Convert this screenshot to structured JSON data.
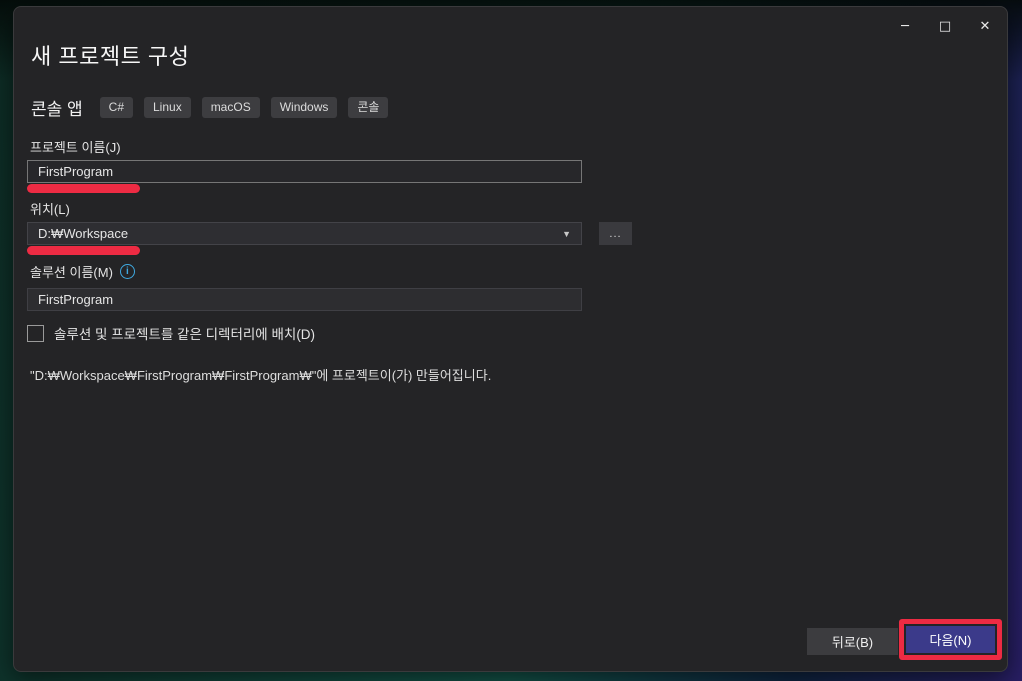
{
  "window": {
    "title": "새 프로젝트 구성",
    "controls": {
      "minimize": "─",
      "maximize": "□",
      "close": "✕"
    }
  },
  "template": {
    "name": "콘솔 앱",
    "tags": [
      "C#",
      "Linux",
      "macOS",
      "Windows",
      "콘솔"
    ]
  },
  "form": {
    "project_name": {
      "label": "프로젝트 이름(J)",
      "value": "FirstProgram"
    },
    "location": {
      "label": "위치(L)",
      "value": "D:₩Workspace",
      "caret": "▼",
      "browse_label": "..."
    },
    "solution_name": {
      "label": "솔루션 이름(M)",
      "info_glyph": "i",
      "value": "FirstProgram"
    },
    "same_directory": {
      "label": "솔루션 및 프로젝트를 같은 디렉터리에 배치(D)",
      "checked": false
    },
    "output_hint": "\"D:₩Workspace₩FirstProgram₩FirstProgram₩\"에 프로젝트이(가) 만들어집니다."
  },
  "footer": {
    "back_label": "뒤로(B)",
    "next_label": "다음(N)"
  },
  "annotations": {
    "marker_color": "#ed2b43"
  },
  "colors": {
    "next_button_accent": "#3b3a8a",
    "dialog_background": "#242426"
  }
}
